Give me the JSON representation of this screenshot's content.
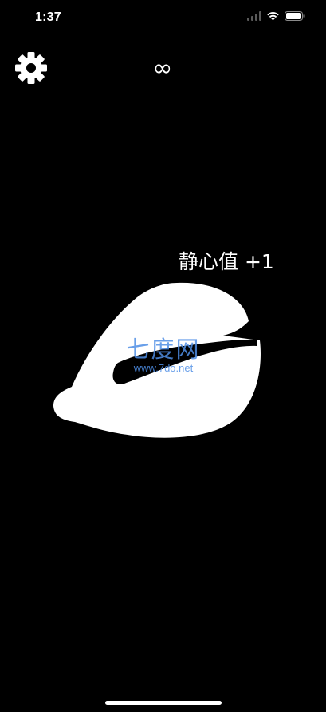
{
  "status_bar": {
    "time": "1:37",
    "icons": [
      "signal-icon",
      "wifi-icon",
      "battery-icon"
    ]
  },
  "header": {
    "settings_icon": "gear-icon",
    "counter": "∞"
  },
  "main": {
    "float_text": "静心值 +1",
    "wooden_fish_icon": "wooden-fish-icon"
  },
  "watermark": {
    "title": "七度网",
    "url": "www.7do.net"
  },
  "colors": {
    "background": "#000000",
    "foreground": "#ffffff",
    "watermark": "#4f8fe6"
  }
}
